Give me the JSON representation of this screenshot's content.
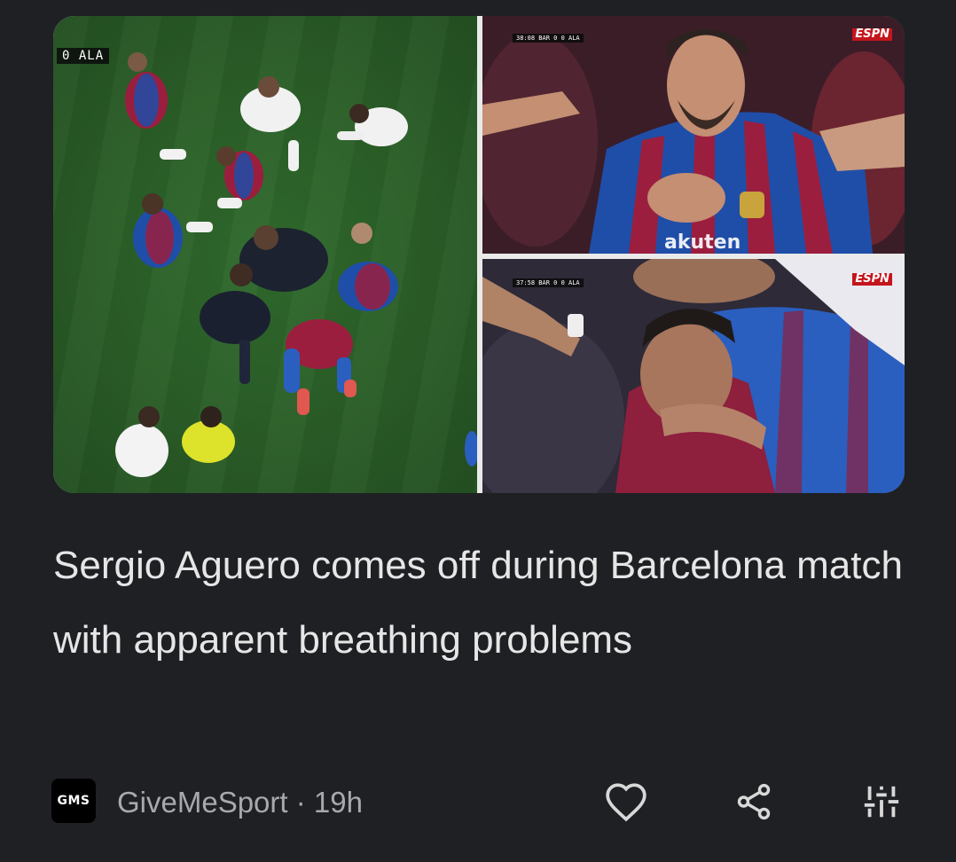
{
  "article": {
    "headline": "Sergio Aguero comes off during Barcelona match with apparent breathing problems",
    "image": {
      "panels": {
        "left": {
          "scoreboard": "0  ALA"
        },
        "top_right": {
          "scoreboard": "38:08  BAR  0  0  ALA",
          "channel_logo": "ESPN"
        },
        "bottom_right": {
          "scoreboard": "37:58  BAR  0  0  ALA",
          "channel_logo": "ESPN"
        }
      }
    }
  },
  "source": {
    "logo_text": "GMS",
    "name": "GiveMeSport",
    "separator": " · ",
    "age": "19h"
  },
  "actions": {
    "like_icon": "heart-outline-icon",
    "share_icon": "share-icon",
    "more_icon": "tune-sliders-icon"
  },
  "colors": {
    "background": "#1f2024",
    "headline_text": "#e6e6e6",
    "meta_text": "#a8a8ad",
    "icon": "#d8d8d8"
  }
}
